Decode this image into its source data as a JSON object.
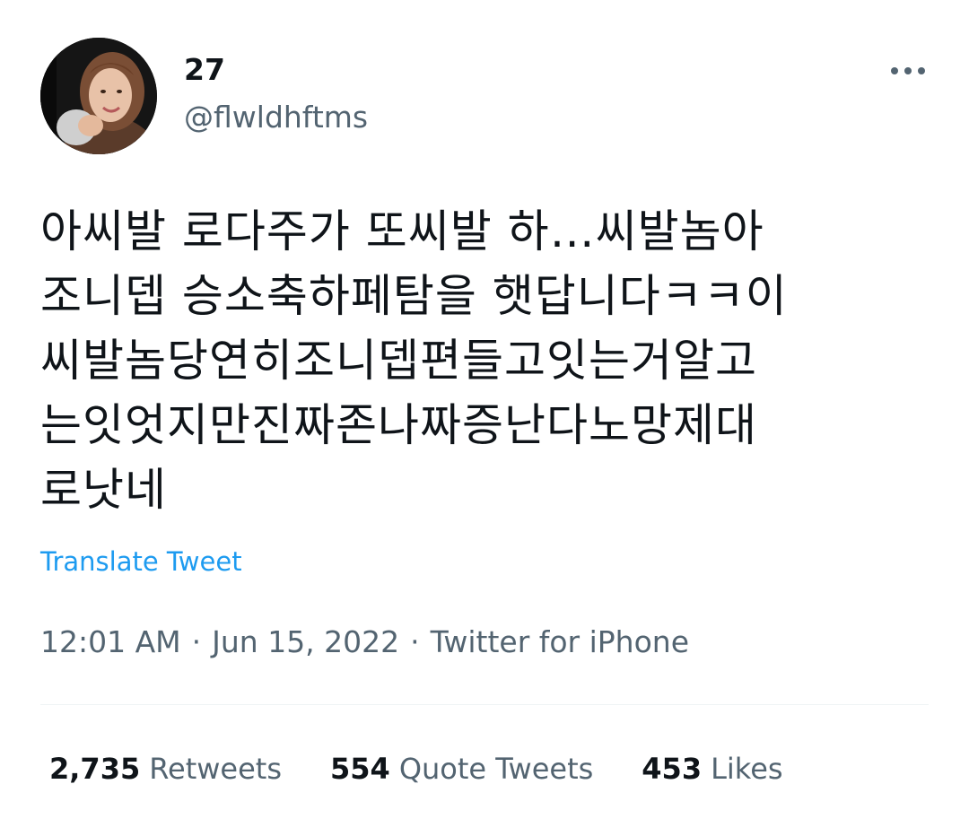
{
  "author": {
    "display_name": "27",
    "handle": "@flwldhftms"
  },
  "tweet": {
    "lines": [
      "아씨발 로다주가 또씨발 하…씨발놈아",
      "조니뎁 승소축하페탐을 햇답니다ㅋㅋ이",
      "씨발놈당연히조니뎁편들고잇는거알고",
      "는잇엇지만진짜존나짜증난다노망제대",
      "로낫네"
    ],
    "translate_label": "Translate Tweet"
  },
  "meta": {
    "time": "12:01 AM",
    "date": "Jun 15, 2022",
    "separator": "·",
    "source": "Twitter for iPhone"
  },
  "stats": {
    "retweets_count": "2,735",
    "retweets_label": "Retweets",
    "quotes_count": "554",
    "quotes_label": "Quote Tweets",
    "likes_count": "453",
    "likes_label": "Likes"
  },
  "icons": {
    "more": "more-horizontal-icon"
  },
  "colors": {
    "text": "#0f1419",
    "secondary": "#536471",
    "link": "#1d9bf0",
    "divider": "#eff3f4"
  }
}
